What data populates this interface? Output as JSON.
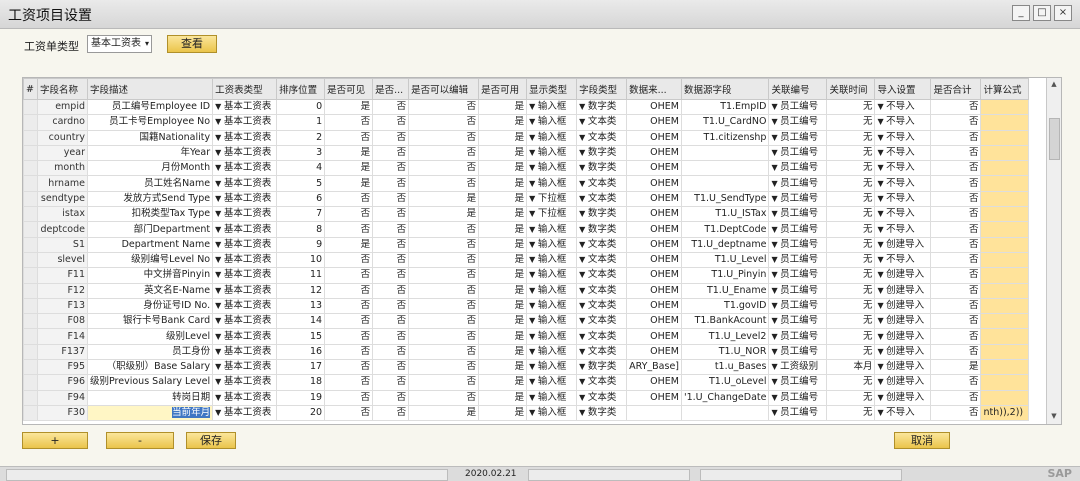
{
  "window": {
    "title": "工资项目设置",
    "controls": [
      "_",
      "□",
      "×"
    ]
  },
  "filter": {
    "label": "工资单类型",
    "value": "基本工资表",
    "query_button": "查看"
  },
  "grid": {
    "columns": [
      "#",
      "字段名称",
      "字段描述",
      "工资表类型",
      "排序位置",
      "是否可见",
      "是否...",
      "是否可以编辑",
      "是否可用",
      "显示类型",
      "字段类型",
      "数据来...",
      "数据源字段",
      "关联编号",
      "关联时间",
      "导入设置",
      "是否合计",
      "计算公式"
    ],
    "rows": [
      {
        "field": "empid",
        "desc": "员工编号Employee ID",
        "type": "基本工资表",
        "pos": "0",
        "visible": "是",
        "c7": "否",
        "editable": "否",
        "usable": "是",
        "display": "输入框",
        "ftype": "数字类",
        "src": "OHEM",
        "srcfield": "T1.EmpID",
        "link": "员工编号",
        "linktime": "无",
        "import": "不导入",
        "sum": "否"
      },
      {
        "field": "cardno",
        "desc": "员工卡号Employee No",
        "type": "基本工资表",
        "pos": "1",
        "visible": "否",
        "c7": "否",
        "editable": "否",
        "usable": "是",
        "display": "输入框",
        "ftype": "文本类",
        "src": "OHEM",
        "srcfield": "T1.U_CardNO",
        "link": "员工编号",
        "linktime": "无",
        "import": "不导入",
        "sum": "否"
      },
      {
        "field": "country",
        "desc": "国籍Nationality",
        "type": "基本工资表",
        "pos": "2",
        "visible": "否",
        "c7": "否",
        "editable": "否",
        "usable": "是",
        "display": "输入框",
        "ftype": "文本类",
        "src": "OHEM",
        "srcfield": "T1.citizenshp",
        "link": "员工编号",
        "linktime": "无",
        "import": "不导入",
        "sum": "否"
      },
      {
        "field": "year",
        "desc": "年Year",
        "type": "基本工资表",
        "pos": "3",
        "visible": "是",
        "c7": "否",
        "editable": "否",
        "usable": "是",
        "display": "输入框",
        "ftype": "数字类",
        "src": "OHEM",
        "srcfield": "",
        "link": "员工编号",
        "linktime": "无",
        "import": "不导入",
        "sum": "否"
      },
      {
        "field": "month",
        "desc": "月份Month",
        "type": "基本工资表",
        "pos": "4",
        "visible": "是",
        "c7": "否",
        "editable": "否",
        "usable": "是",
        "display": "输入框",
        "ftype": "数字类",
        "src": "OHEM",
        "srcfield": "",
        "link": "员工编号",
        "linktime": "无",
        "import": "不导入",
        "sum": "否"
      },
      {
        "field": "hrname",
        "desc": "员工姓名Name",
        "type": "基本工资表",
        "pos": "5",
        "visible": "是",
        "c7": "否",
        "editable": "否",
        "usable": "是",
        "display": "输入框",
        "ftype": "文本类",
        "src": "OHEM",
        "srcfield": "",
        "link": "员工编号",
        "linktime": "无",
        "import": "不导入",
        "sum": "否"
      },
      {
        "field": "sendtype",
        "desc": "发放方式Send Type",
        "type": "基本工资表",
        "pos": "6",
        "visible": "否",
        "c7": "否",
        "editable": "是",
        "usable": "是",
        "display": "下拉框",
        "ftype": "文本类",
        "src": "OHEM",
        "srcfield": "T1.U_SendType",
        "link": "员工编号",
        "linktime": "无",
        "import": "不导入",
        "sum": "否"
      },
      {
        "field": "istax",
        "desc": "扣税类型Tax Type",
        "type": "基本工资表",
        "pos": "7",
        "visible": "否",
        "c7": "否",
        "editable": "是",
        "usable": "是",
        "display": "下拉框",
        "ftype": "数字类",
        "src": "OHEM",
        "srcfield": "T1.U_ISTax",
        "link": "员工编号",
        "linktime": "无",
        "import": "不导入",
        "sum": "否"
      },
      {
        "field": "deptcode",
        "desc": "部门Department",
        "type": "基本工资表",
        "pos": "8",
        "visible": "否",
        "c7": "否",
        "editable": "否",
        "usable": "是",
        "display": "输入框",
        "ftype": "数字类",
        "src": "OHEM",
        "srcfield": "T1.DeptCode",
        "link": "员工编号",
        "linktime": "无",
        "import": "不导入",
        "sum": "否"
      },
      {
        "field": "S1",
        "desc": "Department Name",
        "type": "基本工资表",
        "pos": "9",
        "visible": "是",
        "c7": "否",
        "editable": "否",
        "usable": "是",
        "display": "输入框",
        "ftype": "文本类",
        "src": "OHEM",
        "srcfield": "T1.U_deptname",
        "link": "员工编号",
        "linktime": "无",
        "import": "创建导入",
        "sum": "否"
      },
      {
        "field": "slevel",
        "desc": "级别编号Level No",
        "type": "基本工资表",
        "pos": "10",
        "visible": "否",
        "c7": "否",
        "editable": "否",
        "usable": "是",
        "display": "输入框",
        "ftype": "文本类",
        "src": "OHEM",
        "srcfield": "T1.U_Level",
        "link": "员工编号",
        "linktime": "无",
        "import": "不导入",
        "sum": "否"
      },
      {
        "field": "F11",
        "desc": "中文拼音Pinyin",
        "type": "基本工资表",
        "pos": "11",
        "visible": "否",
        "c7": "否",
        "editable": "否",
        "usable": "是",
        "display": "输入框",
        "ftype": "文本类",
        "src": "OHEM",
        "srcfield": "T1.U_Pinyin",
        "link": "员工编号",
        "linktime": "无",
        "import": "创建导入",
        "sum": "否"
      },
      {
        "field": "F12",
        "desc": "英文名E-Name",
        "type": "基本工资表",
        "pos": "12",
        "visible": "否",
        "c7": "否",
        "editable": "否",
        "usable": "是",
        "display": "输入框",
        "ftype": "文本类",
        "src": "OHEM",
        "srcfield": "T1.U_Ename",
        "link": "员工编号",
        "linktime": "无",
        "import": "创建导入",
        "sum": "否"
      },
      {
        "field": "F13",
        "desc": "身份证号ID No.",
        "type": "基本工资表",
        "pos": "13",
        "visible": "否",
        "c7": "否",
        "editable": "否",
        "usable": "是",
        "display": "输入框",
        "ftype": "文本类",
        "src": "OHEM",
        "srcfield": "T1.govID",
        "link": "员工编号",
        "linktime": "无",
        "import": "创建导入",
        "sum": "否"
      },
      {
        "field": "F08",
        "desc": "银行卡号Bank Card",
        "type": "基本工资表",
        "pos": "14",
        "visible": "否",
        "c7": "否",
        "editable": "否",
        "usable": "是",
        "display": "输入框",
        "ftype": "文本类",
        "src": "OHEM",
        "srcfield": "T1.BankAcount",
        "link": "员工编号",
        "linktime": "无",
        "import": "创建导入",
        "sum": "否"
      },
      {
        "field": "F14",
        "desc": "级别Level",
        "type": "基本工资表",
        "pos": "15",
        "visible": "否",
        "c7": "否",
        "editable": "否",
        "usable": "是",
        "display": "输入框",
        "ftype": "文本类",
        "src": "OHEM",
        "srcfield": "T1.U_Level2",
        "link": "员工编号",
        "linktime": "无",
        "import": "创建导入",
        "sum": "否"
      },
      {
        "field": "F137",
        "desc": "员工身份",
        "type": "基本工资表",
        "pos": "16",
        "visible": "否",
        "c7": "否",
        "editable": "否",
        "usable": "是",
        "display": "输入框",
        "ftype": "文本类",
        "src": "OHEM",
        "srcfield": "T1.U_NOR",
        "link": "员工编号",
        "linktime": "无",
        "import": "创建导入",
        "sum": "否"
      },
      {
        "field": "F95",
        "desc": "（职级别）Base Salary",
        "type": "基本工资表",
        "pos": "17",
        "visible": "否",
        "c7": "否",
        "editable": "否",
        "usable": "是",
        "display": "输入框",
        "ftype": "数字类",
        "src": "ARY_Base]",
        "srcfield": "t1.u_Bases",
        "link": "工资级别",
        "linktime": "本月",
        "import": "创建导入",
        "sum": "是"
      },
      {
        "field": "F96",
        "desc": "级别Previous Salary Level",
        "type": "基本工资表",
        "pos": "18",
        "visible": "否",
        "c7": "否",
        "editable": "否",
        "usable": "是",
        "display": "输入框",
        "ftype": "文本类",
        "src": "OHEM",
        "srcfield": "T1.U_oLevel",
        "link": "员工编号",
        "linktime": "无",
        "import": "创建导入",
        "sum": "否"
      },
      {
        "field": "F94",
        "desc": "转岗日期",
        "type": "基本工资表",
        "pos": "19",
        "visible": "否",
        "c7": "否",
        "editable": "否",
        "usable": "是",
        "display": "输入框",
        "ftype": "文本类",
        "src": "OHEM",
        "srcfield": "'1.U_ChangeDate",
        "link": "员工编号",
        "linktime": "无",
        "import": "创建导入",
        "sum": "否"
      },
      {
        "field": "F30",
        "desc": "当前年月",
        "type": "基本工资表",
        "pos": "20",
        "visible": "否",
        "c7": "否",
        "editable": "是",
        "usable": "是",
        "display": "输入框",
        "ftype": "数字类",
        "src": "",
        "srcfield": "",
        "link": "员工编号",
        "linktime": "无",
        "import": "不导入",
        "sum": "否",
        "formula": "nth)),2))"
      }
    ]
  },
  "buttons": {
    "add": "+",
    "remove": "-",
    "save": "保存",
    "cancel": "取消"
  },
  "status": {
    "date": "2020.02.21",
    "brand": "SAP"
  }
}
